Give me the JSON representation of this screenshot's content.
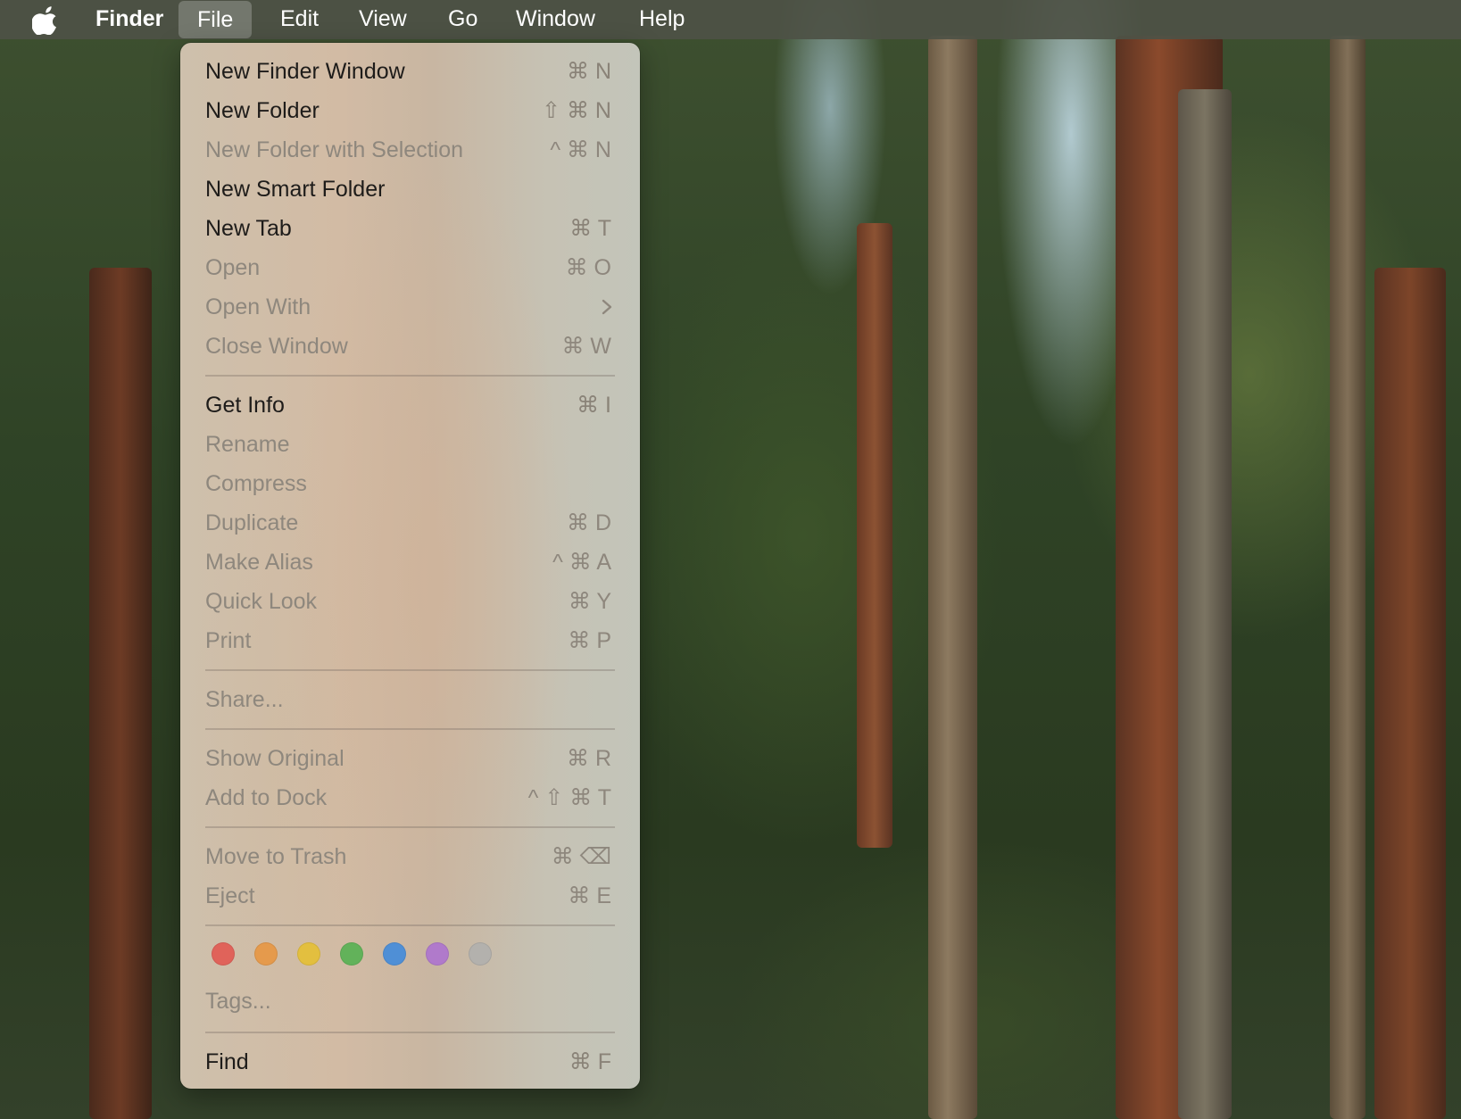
{
  "menubar": {
    "app_name": "Finder",
    "menus": [
      "File",
      "Edit",
      "View",
      "Go",
      "Window",
      "Help"
    ],
    "active_menu": "File"
  },
  "file_menu": {
    "items": [
      {
        "label": "New Finder Window",
        "shortcut": "⌘ N",
        "enabled": true
      },
      {
        "label": "New Folder",
        "shortcut": "⇧ ⌘ N",
        "enabled": true
      },
      {
        "label": "New Folder with Selection",
        "shortcut": "^ ⌘ N",
        "enabled": false
      },
      {
        "label": "New Smart Folder",
        "shortcut": "",
        "enabled": true
      },
      {
        "label": "New Tab",
        "shortcut": "⌘ T",
        "enabled": true
      },
      {
        "label": "Open",
        "shortcut": "⌘ O",
        "enabled": false
      },
      {
        "label": "Open With",
        "shortcut": "",
        "enabled": false,
        "submenu": true
      },
      {
        "label": "Close Window",
        "shortcut": "⌘ W",
        "enabled": false
      },
      {
        "label": "Get Info",
        "shortcut": "⌘ I",
        "enabled": true
      },
      {
        "label": "Rename",
        "shortcut": "",
        "enabled": false
      },
      {
        "label": "Compress",
        "shortcut": "",
        "enabled": false
      },
      {
        "label": "Duplicate",
        "shortcut": "⌘ D",
        "enabled": false
      },
      {
        "label": "Make Alias",
        "shortcut": "^ ⌘ A",
        "enabled": false
      },
      {
        "label": "Quick Look",
        "shortcut": "⌘ Y",
        "enabled": false
      },
      {
        "label": "Print",
        "shortcut": "⌘ P",
        "enabled": false
      },
      {
        "label": "Share...",
        "shortcut": "",
        "enabled": false
      },
      {
        "label": "Show Original",
        "shortcut": "⌘ R",
        "enabled": false
      },
      {
        "label": "Add to Dock",
        "shortcut": "^ ⇧ ⌘ T",
        "enabled": false
      },
      {
        "label": "Move to Trash",
        "shortcut": "⌘ ⌫",
        "enabled": false
      },
      {
        "label": "Eject",
        "shortcut": "⌘ E",
        "enabled": false
      },
      {
        "label": "Tags...",
        "shortcut": "",
        "enabled": false
      },
      {
        "label": "Find",
        "shortcut": "⌘ F",
        "enabled": true
      }
    ],
    "tag_colors": [
      {
        "name": "red",
        "color": "#e0635a"
      },
      {
        "name": "orange",
        "color": "#e59a4c"
      },
      {
        "name": "yellow",
        "color": "#e3bf3f"
      },
      {
        "name": "green",
        "color": "#62b25a"
      },
      {
        "name": "blue",
        "color": "#4f8fd6"
      },
      {
        "name": "purple",
        "color": "#b07acb"
      },
      {
        "name": "gray",
        "color": "#b3b1ad"
      }
    ]
  }
}
